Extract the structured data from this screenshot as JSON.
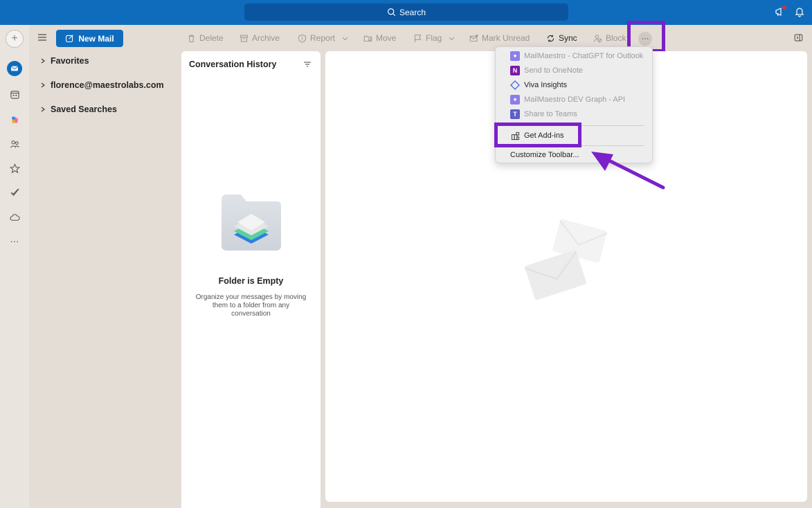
{
  "titlebar": {
    "search_label": "Search",
    "icons": [
      "search-icon",
      "megaphone-icon",
      "bell-icon"
    ]
  },
  "rail": {
    "icons": [
      "compose-icon",
      "mail-icon",
      "calendar-icon",
      "copilot-icon",
      "people-icon",
      "favorites-icon",
      "todo-icon",
      "cloud-icon",
      "more-apps-icon"
    ]
  },
  "toolbar": {
    "new_mail": "New Mail",
    "delete": "Delete",
    "archive": "Archive",
    "report": "Report",
    "move": "Move",
    "flag": "Flag",
    "mark_unread": "Mark Unread",
    "sync": "Sync",
    "block": "Block",
    "more": "···"
  },
  "folders": {
    "items": [
      {
        "label": "Favorites"
      },
      {
        "label": "florence@maestrolabs.com"
      },
      {
        "label": "Saved Searches"
      }
    ]
  },
  "list": {
    "title": "Conversation History",
    "empty_title": "Folder is Empty",
    "empty_desc": "Organize your messages by moving them to a folder from any conversation"
  },
  "menu": {
    "items": [
      {
        "label": "MailMaestro - ChatGPT for Outlook",
        "enabled": false,
        "icon": "mailmaestro-icon"
      },
      {
        "label": "Send to OneNote",
        "enabled": false,
        "icon": "onenote-icon"
      },
      {
        "label": "Viva Insights",
        "enabled": true,
        "icon": "viva-insights-icon"
      },
      {
        "label": "MailMaestro DEV Graph - API",
        "enabled": false,
        "icon": "mailmaestro-icon"
      },
      {
        "label": "Share to Teams",
        "enabled": false,
        "icon": "teams-icon"
      }
    ],
    "get_addins": "Get Add-ins",
    "customize": "Customize Toolbar..."
  },
  "colors": {
    "accent": "#0f6cbd",
    "highlight": "#7a21c9"
  }
}
